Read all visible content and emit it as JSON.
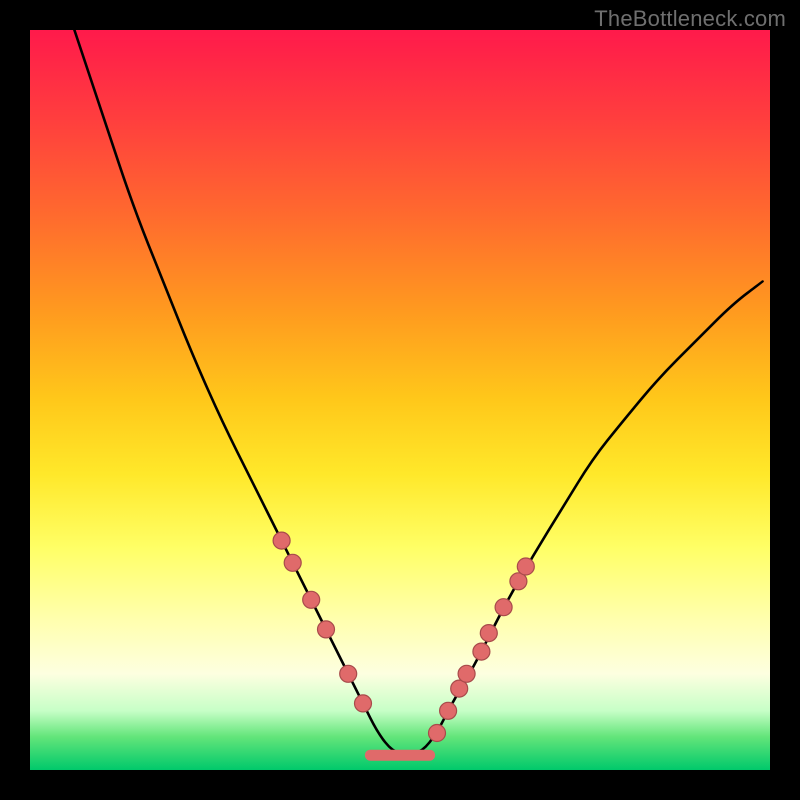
{
  "watermark": "TheBottleneck.com",
  "chart_data": {
    "type": "line",
    "title": "",
    "xlabel": "",
    "ylabel": "",
    "xlim": [
      0,
      100
    ],
    "ylim": [
      0,
      100
    ],
    "series": [
      {
        "name": "bottleneck-curve",
        "color": "#000000",
        "x": [
          6,
          10,
          14,
          18,
          22,
          26,
          30,
          34,
          38,
          41,
          43,
          45,
          47,
          49,
          51,
          53,
          55,
          57,
          60,
          64,
          68,
          72,
          76,
          80,
          85,
          90,
          95,
          99
        ],
        "y": [
          100,
          88,
          76,
          66,
          56,
          47,
          39,
          31,
          23,
          17,
          13,
          9,
          5,
          2.5,
          2,
          2.5,
          5,
          9,
          14,
          22,
          29,
          35.5,
          42,
          47,
          53,
          58,
          63,
          66
        ]
      }
    ],
    "markers": {
      "name": "highlight-points",
      "color": "#e06a6a",
      "points": [
        {
          "x": 34,
          "y": 31
        },
        {
          "x": 35.5,
          "y": 28
        },
        {
          "x": 38,
          "y": 23
        },
        {
          "x": 40,
          "y": 19
        },
        {
          "x": 43,
          "y": 13
        },
        {
          "x": 45,
          "y": 9
        },
        {
          "x": 55,
          "y": 5
        },
        {
          "x": 56.5,
          "y": 8
        },
        {
          "x": 58,
          "y": 11
        },
        {
          "x": 59,
          "y": 13
        },
        {
          "x": 61,
          "y": 16
        },
        {
          "x": 62,
          "y": 18.5
        },
        {
          "x": 64,
          "y": 22
        },
        {
          "x": 66,
          "y": 25.5
        },
        {
          "x": 67,
          "y": 27.5
        }
      ]
    },
    "flat_segment": {
      "x0": 46,
      "x1": 54,
      "y": 2
    }
  }
}
